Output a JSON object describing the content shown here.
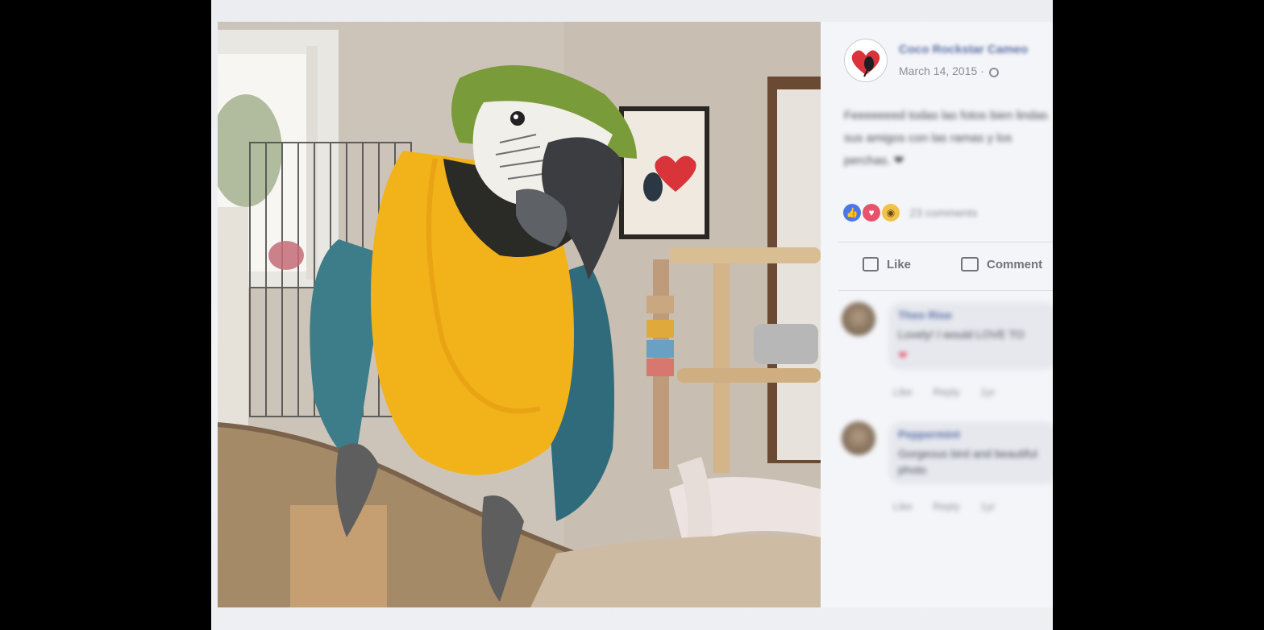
{
  "post": {
    "author": "Coco Rockstar Cameo",
    "date": "March 14, 2015 ·",
    "privacy_icon": "globe-icon",
    "text": "Feeeeeeed todas las fotos bien lindas sus amigos con las ramas y los perchas. ❤",
    "reactions": [
      "like-icon",
      "love-icon",
      "wow-icon"
    ],
    "reaction_count": "23 comments",
    "like_label": "Like",
    "comment_label": "Comment"
  },
  "comments": [
    {
      "name": "Theo Rise",
      "text": "Lovely! I would LOVE TO",
      "emoji": "❤",
      "actions": "Like Reply 1yr"
    },
    {
      "name": "Peppermint",
      "text": "Gorgeous bird and beautiful photo",
      "emoji": "",
      "actions": "Like Reply 1yr"
    }
  ],
  "photo": {
    "subject": "blue-and-gold macaw perched on a wooden branch indoors"
  },
  "colors": {
    "page_bg": "#000000",
    "paper": "#eeeff3",
    "link_blue": "#5b6fa6",
    "muted_text": "#8c8f97",
    "like_blue": "#4a79e6",
    "love_red": "#e7536b",
    "wow_yellow": "#f1c24a"
  }
}
